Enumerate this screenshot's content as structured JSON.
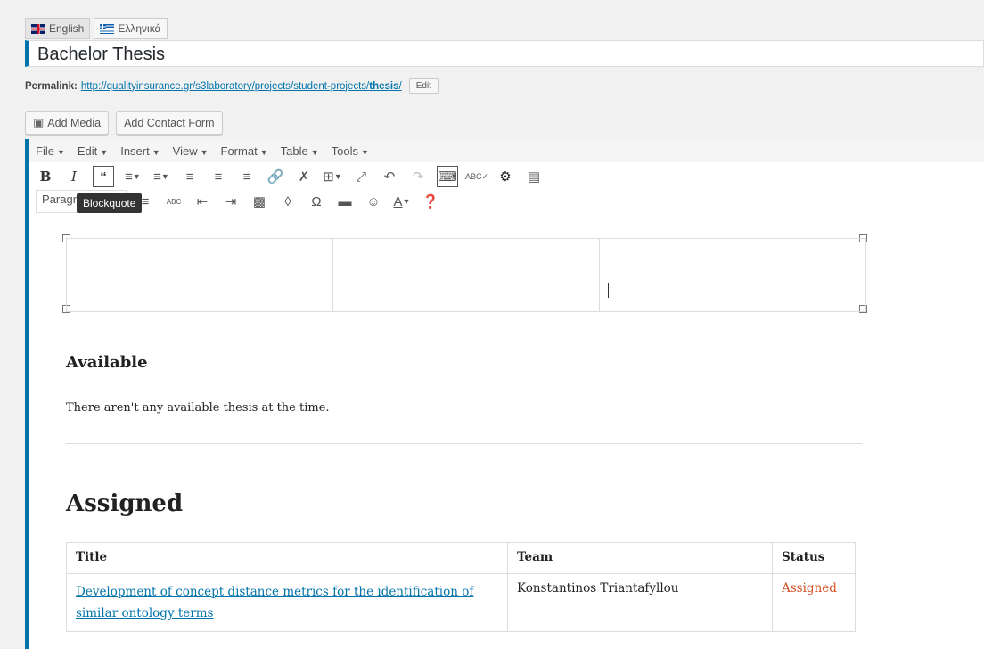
{
  "languages": [
    {
      "label": "English",
      "flag": "uk-flag-icon"
    },
    {
      "label": "Ελληνικά",
      "flag": "greek-flag-icon"
    }
  ],
  "post": {
    "title": "Bachelor Thesis",
    "permalink_label": "Permalink:",
    "permalink_url": "http://qualityinsurance.gr/s3laboratory/projects/student-projects/thesis/",
    "permalink_base": "http://qualityinsurance.gr/s3laboratory/projects/student-projects/",
    "permalink_slug": "thesis",
    "permalink_trailing": "/",
    "edit_label": "Edit"
  },
  "media_buttons": {
    "add_media": "Add Media",
    "add_contact_form": "Add Contact Form"
  },
  "editor": {
    "menu": [
      "File",
      "Edit",
      "Insert",
      "View",
      "Format",
      "Table",
      "Tools"
    ],
    "paragraph_select": "Paragraph",
    "tooltip": "Blockquote",
    "accent_color": "#0073aa"
  },
  "content": {
    "available_heading": "Available",
    "available_note": "There aren't any available thesis at the time.",
    "assigned_heading": "Assigned",
    "table": {
      "headers": [
        "Title",
        "Team",
        "Status"
      ],
      "rows": [
        {
          "title": "Development of concept distance metrics for the identification of similar ontology terms",
          "team": "Konstantinos Triantafyllou",
          "status": "Assigned"
        }
      ]
    },
    "status_color": "#d54e21"
  }
}
